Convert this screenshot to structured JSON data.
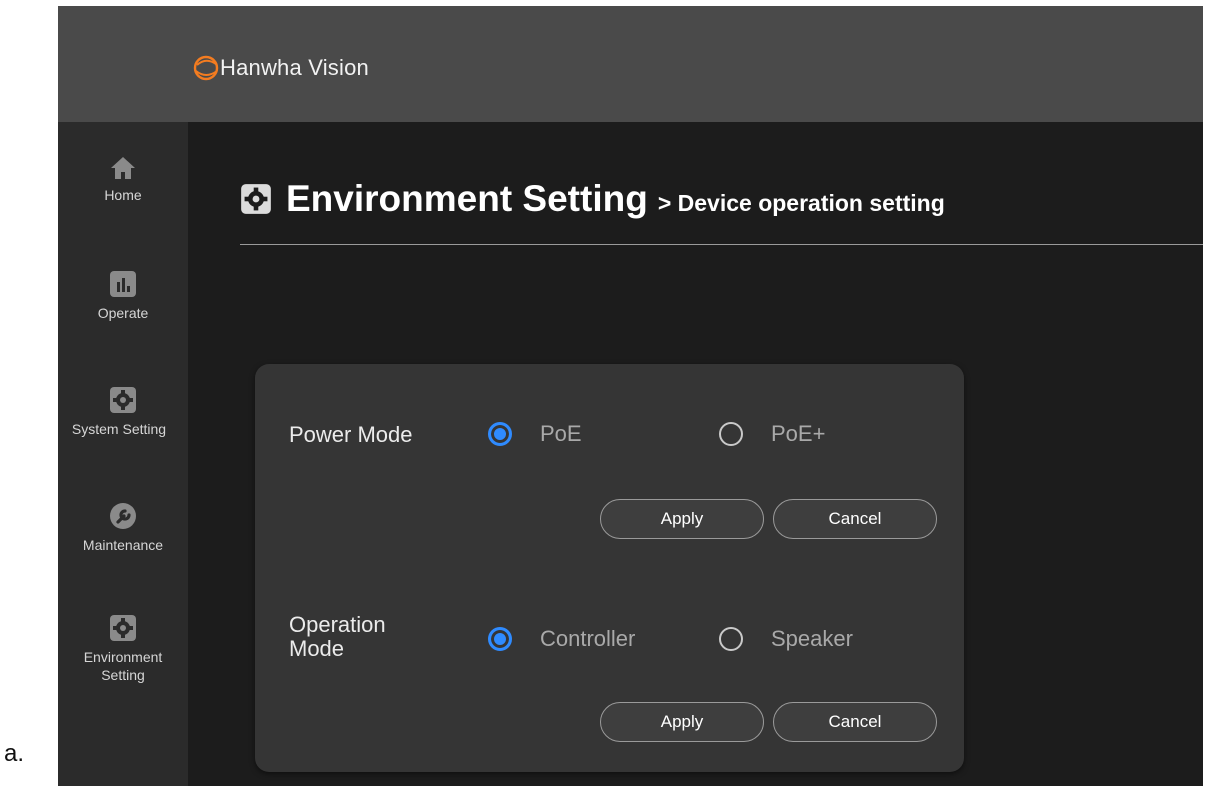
{
  "outer_label": "a.",
  "header": {
    "brand": "Hanwha Vision"
  },
  "sidebar": {
    "items": [
      {
        "label": "Home",
        "icon": "home-icon"
      },
      {
        "label": "Operate",
        "icon": "chart-icon"
      },
      {
        "label": "System Setting",
        "icon": "gear-icon"
      },
      {
        "label": "Maintenance",
        "icon": "wrench-icon"
      },
      {
        "label": "Environment Setting",
        "icon": "gear-icon"
      }
    ]
  },
  "page": {
    "title": "Environment Setting",
    "subtitle": "> Device operation setting",
    "title_icon": "gear-icon"
  },
  "power_mode": {
    "label": "Power Mode",
    "options": [
      "PoE",
      "PoE+"
    ],
    "selected": "PoE",
    "apply_label": "Apply",
    "cancel_label": "Cancel"
  },
  "operation_mode": {
    "label": "Operation Mode",
    "options": [
      "Controller",
      "Speaker"
    ],
    "selected": "Controller",
    "apply_label": "Apply",
    "cancel_label": "Cancel"
  },
  "colors": {
    "accent": "#2f8bff",
    "header_bg": "#4a4a4a",
    "sidebar_bg": "#2b2b2b",
    "panel_bg": "#353535",
    "logo_orange": "#f47c20"
  }
}
